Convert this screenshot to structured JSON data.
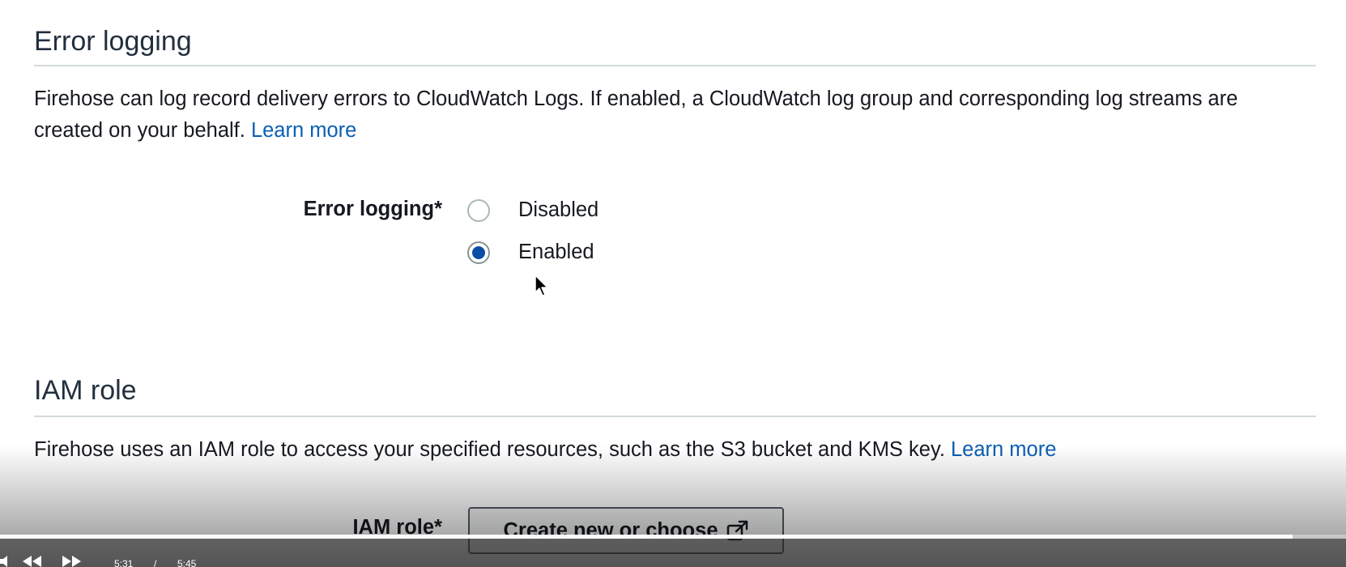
{
  "error_logging": {
    "section_title": "Error logging",
    "description": "Firehose can log record delivery errors to CloudWatch Logs. If enabled, a CloudWatch log group and corresponding log streams are created on your behalf.",
    "learn_more": "Learn more",
    "field_label": "Error logging*",
    "options": [
      {
        "label": "Disabled",
        "checked": false
      },
      {
        "label": "Enabled",
        "checked": true
      }
    ]
  },
  "iam_role": {
    "section_title": "IAM role",
    "description": "Firehose uses an IAM role to access your specified resources, such as the S3 bucket and KMS key.",
    "learn_more": "Learn more",
    "field_label": "IAM role*",
    "button_label": "Create new or choose",
    "button_icon": "external-link-icon"
  },
  "player": {
    "current_time": "5:31",
    "separator": "/",
    "duration": "5:45",
    "progress": 0.96,
    "icons": [
      "volume-icon",
      "rewind-icon",
      "fast-forward-icon"
    ]
  },
  "colors": {
    "link": "#0a5fb4",
    "radio_selected": "#0a4fa3",
    "heading": "#232f3e"
  }
}
